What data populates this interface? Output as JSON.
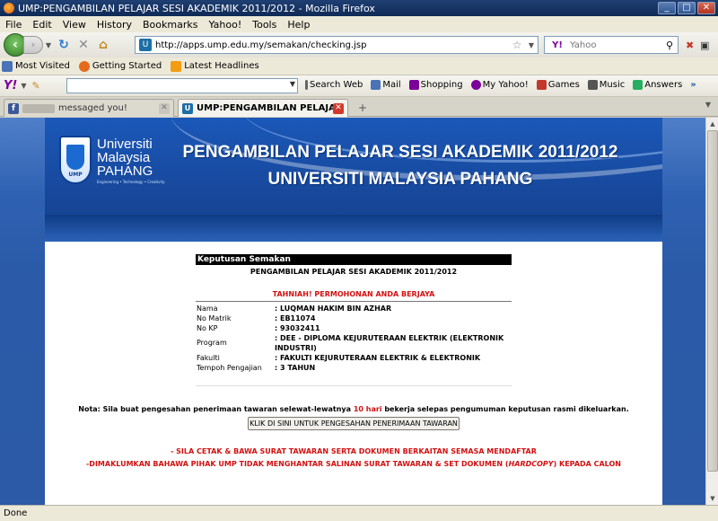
{
  "window": {
    "title": "UMP:PENGAMBILAN PELAJAR SESI AKADEMIK 2011/2012 - Mozilla Firefox"
  },
  "menu": [
    "File",
    "Edit",
    "View",
    "History",
    "Bookmarks",
    "Yahoo!",
    "Tools",
    "Help"
  ],
  "nav": {
    "url": "http://apps.ump.edu.my/semakan/checking.jsp",
    "search_placeholder": "Yahoo",
    "search_engine": "Y!"
  },
  "bookmarks": [
    {
      "label": "Most Visited",
      "icon": "bookmark-folder-icon",
      "color": "#4a73b8"
    },
    {
      "label": "Getting Started",
      "icon": "firefox-icon",
      "color": "#e56a1c"
    },
    {
      "label": "Latest Headlines",
      "icon": "rss-icon",
      "color": "#f39c12"
    }
  ],
  "yahoo_toolbar": {
    "logo": "Y!",
    "items": [
      {
        "label": "Search Web",
        "icon": "search-icon",
        "color": "#666666"
      },
      {
        "label": "Mail",
        "icon": "mail-icon",
        "color": "#4a73b8"
      },
      {
        "label": "Shopping",
        "icon": "shopping-icon",
        "color": "#7b0099"
      },
      {
        "label": "My Yahoo!",
        "icon": "my-yahoo-icon",
        "color": "#7b0099"
      },
      {
        "label": "Games",
        "icon": "games-icon",
        "color": "#c0392b"
      },
      {
        "label": "Music",
        "icon": "music-icon",
        "color": "#555555"
      },
      {
        "label": "Answers",
        "icon": "answers-icon",
        "color": "#27ae60"
      }
    ]
  },
  "tabs": [
    {
      "label": "messaged you!",
      "active": false,
      "icon": "facebook-icon"
    },
    {
      "label": "UMP:PENGAMBILAN PELAJAR SESI...",
      "active": true,
      "icon": "ump-icon"
    }
  ],
  "banner": {
    "logo_line1": "Universiti",
    "logo_line2": "Malaysia",
    "logo_line3": "PAHANG",
    "logo_tagline": "Engineering • Technology • Creativity",
    "logo_seal": "UMP",
    "heading_line1": "PENGAMBILAN PELAJAR SESI AKADEMIK 2011/2012",
    "heading_line2": "UNIVERSITI MALAYSIA PAHANG"
  },
  "result": {
    "header": "Keputusan Semakan",
    "subtitle": "PENGAMBILAN PELAJAR SESI AKADEMIK 2011/2012",
    "congrats": "TAHNIAH!  PERMOHONAN ANDA BERJAYA",
    "rows": [
      {
        "key": "Nama",
        "value": ": LUQMAN HAKIM BIN AZHAR"
      },
      {
        "key": "No Matrik",
        "value": ": EB11074"
      },
      {
        "key": "No KP",
        "value": ": 93032411"
      },
      {
        "key": "Program",
        "value": ": DEE - DIPLOMA KEJURUTERAAN ELEKTRIK (ELEKTRONIK INDUSTRI)"
      },
      {
        "key": "Fakulti",
        "value": ": FAKULTI KEJURUTERAAN ELEKTRIK & ELEKTRONIK"
      },
      {
        "key": "Tempoh Pengajian",
        "value": ": 3 TAHUN"
      }
    ]
  },
  "notice": {
    "before": "Nota: Sila buat pengesahan penerimaan tawaran selewat-lewatnya ",
    "highlight": "10 hari",
    "after": " bekerja selepas pengumuman keputusan rasmi dikeluarkan.",
    "button": "KLIK DI SINI UNTUK PENGESAHAN PENERIMAAN TAWARAN",
    "warning1": "- SILA CETAK & BAWA SURAT TAWARAN SERTA DOKUMEN BERKAITAN SEMASA MENDAFTAR",
    "warning2_before": "-DIMAKLUMKAN BAHAWA PIHAK UMP TIDAK MENGHANTAR SALINAN SURAT TAWARAN & SET DOKUMEN (",
    "warning2_em": "HARDCOPY",
    "warning2_after": ") KEPADA CALON"
  },
  "status": "Done"
}
